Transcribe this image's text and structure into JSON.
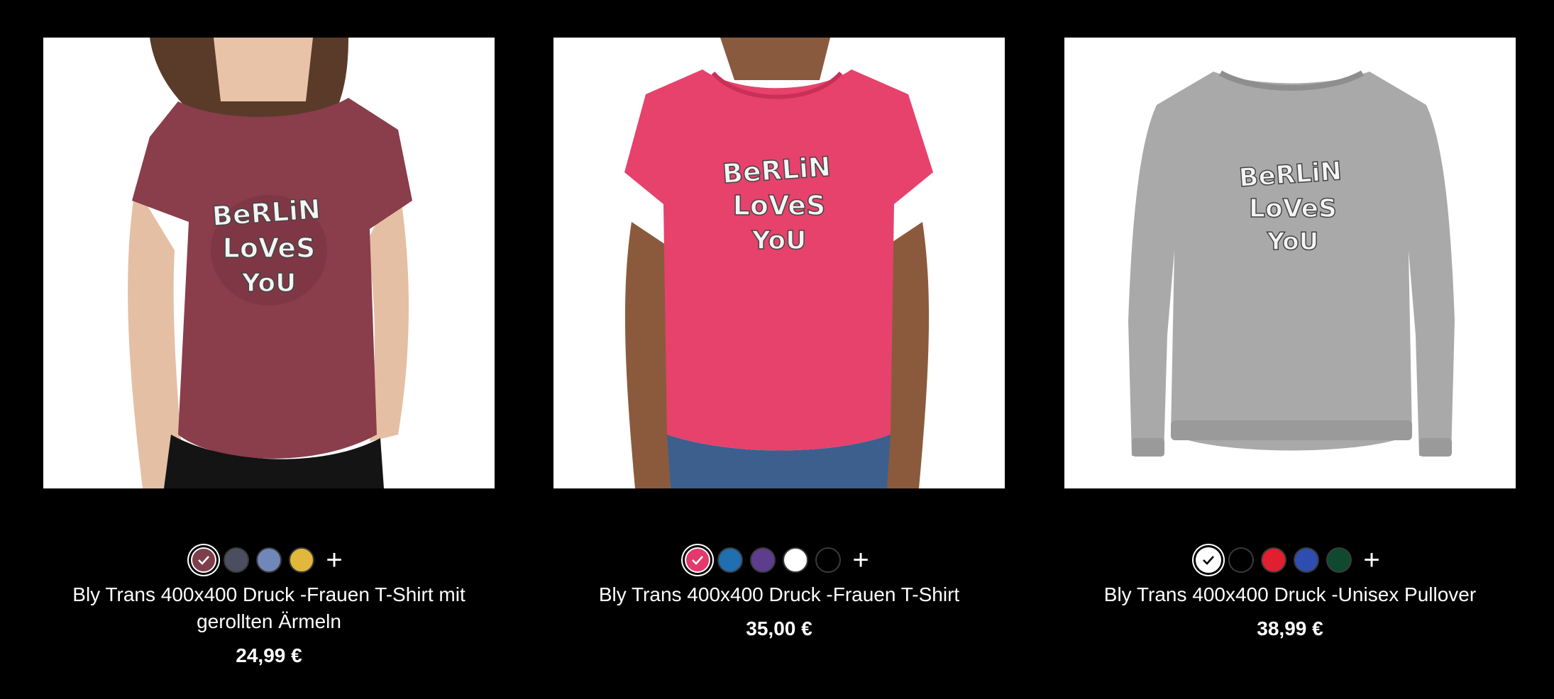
{
  "products": [
    {
      "title": "Bly Trans 400x400 Druck -Frauen T-Shirt mit gerollten Ärmeln",
      "price": "24,99 €",
      "image_alt": "Frauen T-Shirt mit gerollten Ärmeln, bordeaux meliert, Berlin Loves You Druck",
      "design_text": [
        "BeRLiN",
        "LoVeS",
        "YoU"
      ],
      "garment_color": "#8a3d4a",
      "swatches": [
        {
          "color": "#7d3f4b",
          "selected": true
        },
        {
          "color": "#4b4e5e",
          "selected": false
        },
        {
          "color": "#7088b9",
          "selected": false
        },
        {
          "color": "#e1b73c",
          "selected": false
        }
      ],
      "more_label": "+"
    },
    {
      "title": "Bly Trans 400x400 Druck -Frauen T-Shirt",
      "price": "35,00 €",
      "image_alt": "Frauen T-Shirt, azalea pink, Berlin Loves You Druck",
      "design_text": [
        "BeRLiN",
        "LoVeS",
        "YoU"
      ],
      "garment_color": "#e6426c",
      "swatches": [
        {
          "color": "#e5396b",
          "selected": true
        },
        {
          "color": "#1f6fb1",
          "selected": false
        },
        {
          "color": "#5e3d8f",
          "selected": false
        },
        {
          "color": "#ffffff",
          "selected": false
        },
        {
          "color": "#000000",
          "selected": false
        }
      ],
      "more_label": "+"
    },
    {
      "title": "Bly Trans 400x400 Druck -Unisex Pullover",
      "price": "38,99 €",
      "image_alt": "Unisex Pullover, grau meliert, Berlin Loves You Druck",
      "design_text": [
        "BeRLiN",
        "LoVeS",
        "YoU"
      ],
      "garment_color": "#a9a9a9",
      "swatches": [
        {
          "color": "#ffffff",
          "selected": true
        },
        {
          "color": "#000000",
          "selected": false
        },
        {
          "color": "#e21f2e",
          "selected": false
        },
        {
          "color": "#2f4db0",
          "selected": false
        },
        {
          "color": "#0f4a2e",
          "selected": false
        }
      ],
      "more_label": "+"
    }
  ]
}
